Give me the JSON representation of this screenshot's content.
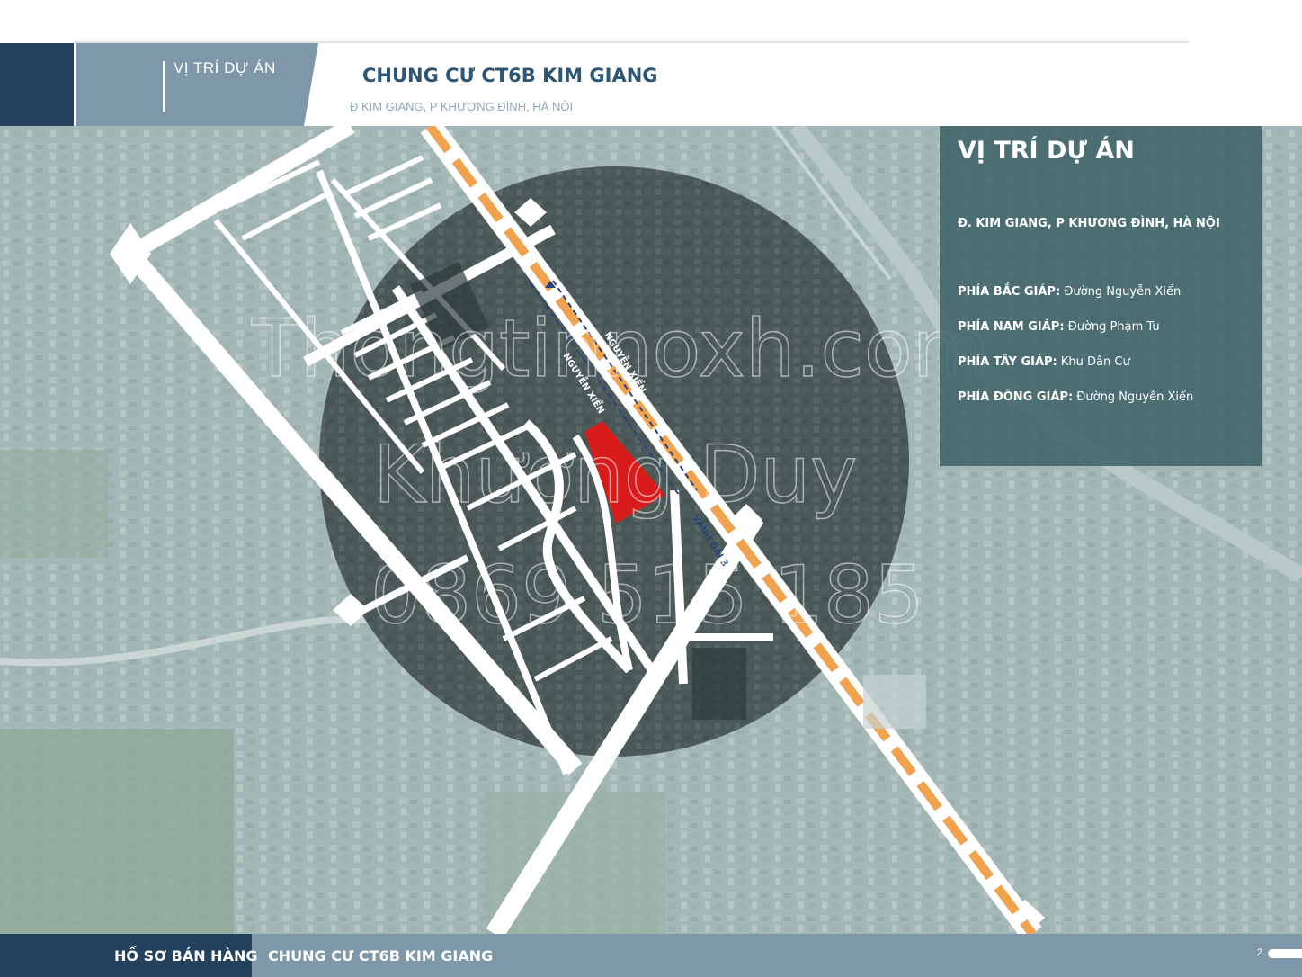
{
  "header": {
    "section_label": "VỊ TRÍ DỰ ÁN",
    "project_title": "CHUNG CƯ CT6B KIM GIANG",
    "project_address": "Đ KIM GIANG, P KHƯƠNG ĐÌNH, HÀ NỘI"
  },
  "map": {
    "road_labels": {
      "nguyen_xien_1": "NGUYỄN XIỂN",
      "nguyen_xien_2": "NGUYỄN XIỂN",
      "vanh_dai_3": "VÀNH ĐAI 3"
    },
    "watermark": {
      "line1": "Thongtinnoxh.com",
      "line2": "Khương Duy",
      "line3": "0869 515 185"
    },
    "colors": {
      "site_plot": "#d81b1b",
      "ring_road": "#f0a24e",
      "highlight_circle": "#3f4b4d",
      "road": "#ffffff"
    }
  },
  "info_panel": {
    "title": "VỊ TRÍ DỰ ÁN",
    "address": "Đ. KIM GIANG, P KHƯƠNG ĐÌNH, HÀ NỘI",
    "borders": [
      {
        "label": "PHÍA BẮC GIÁP:",
        "value": "Đường Nguyễn Xiển"
      },
      {
        "label": "PHÍA NAM GIÁP:",
        "value": "Đường Phạm Tu"
      },
      {
        "label": "PHÍA TÂY GIÁP:",
        "value": "Khu Dân Cư"
      },
      {
        "label": "PHÍA ĐÔNG GIÁP:",
        "value": "Đường Nguyễn Xiển"
      }
    ]
  },
  "footer": {
    "left_label": "HỒ SƠ BÁN HÀNG",
    "right_label": "CHUNG CƯ CT6B KIM GIANG",
    "page_number": "2"
  }
}
